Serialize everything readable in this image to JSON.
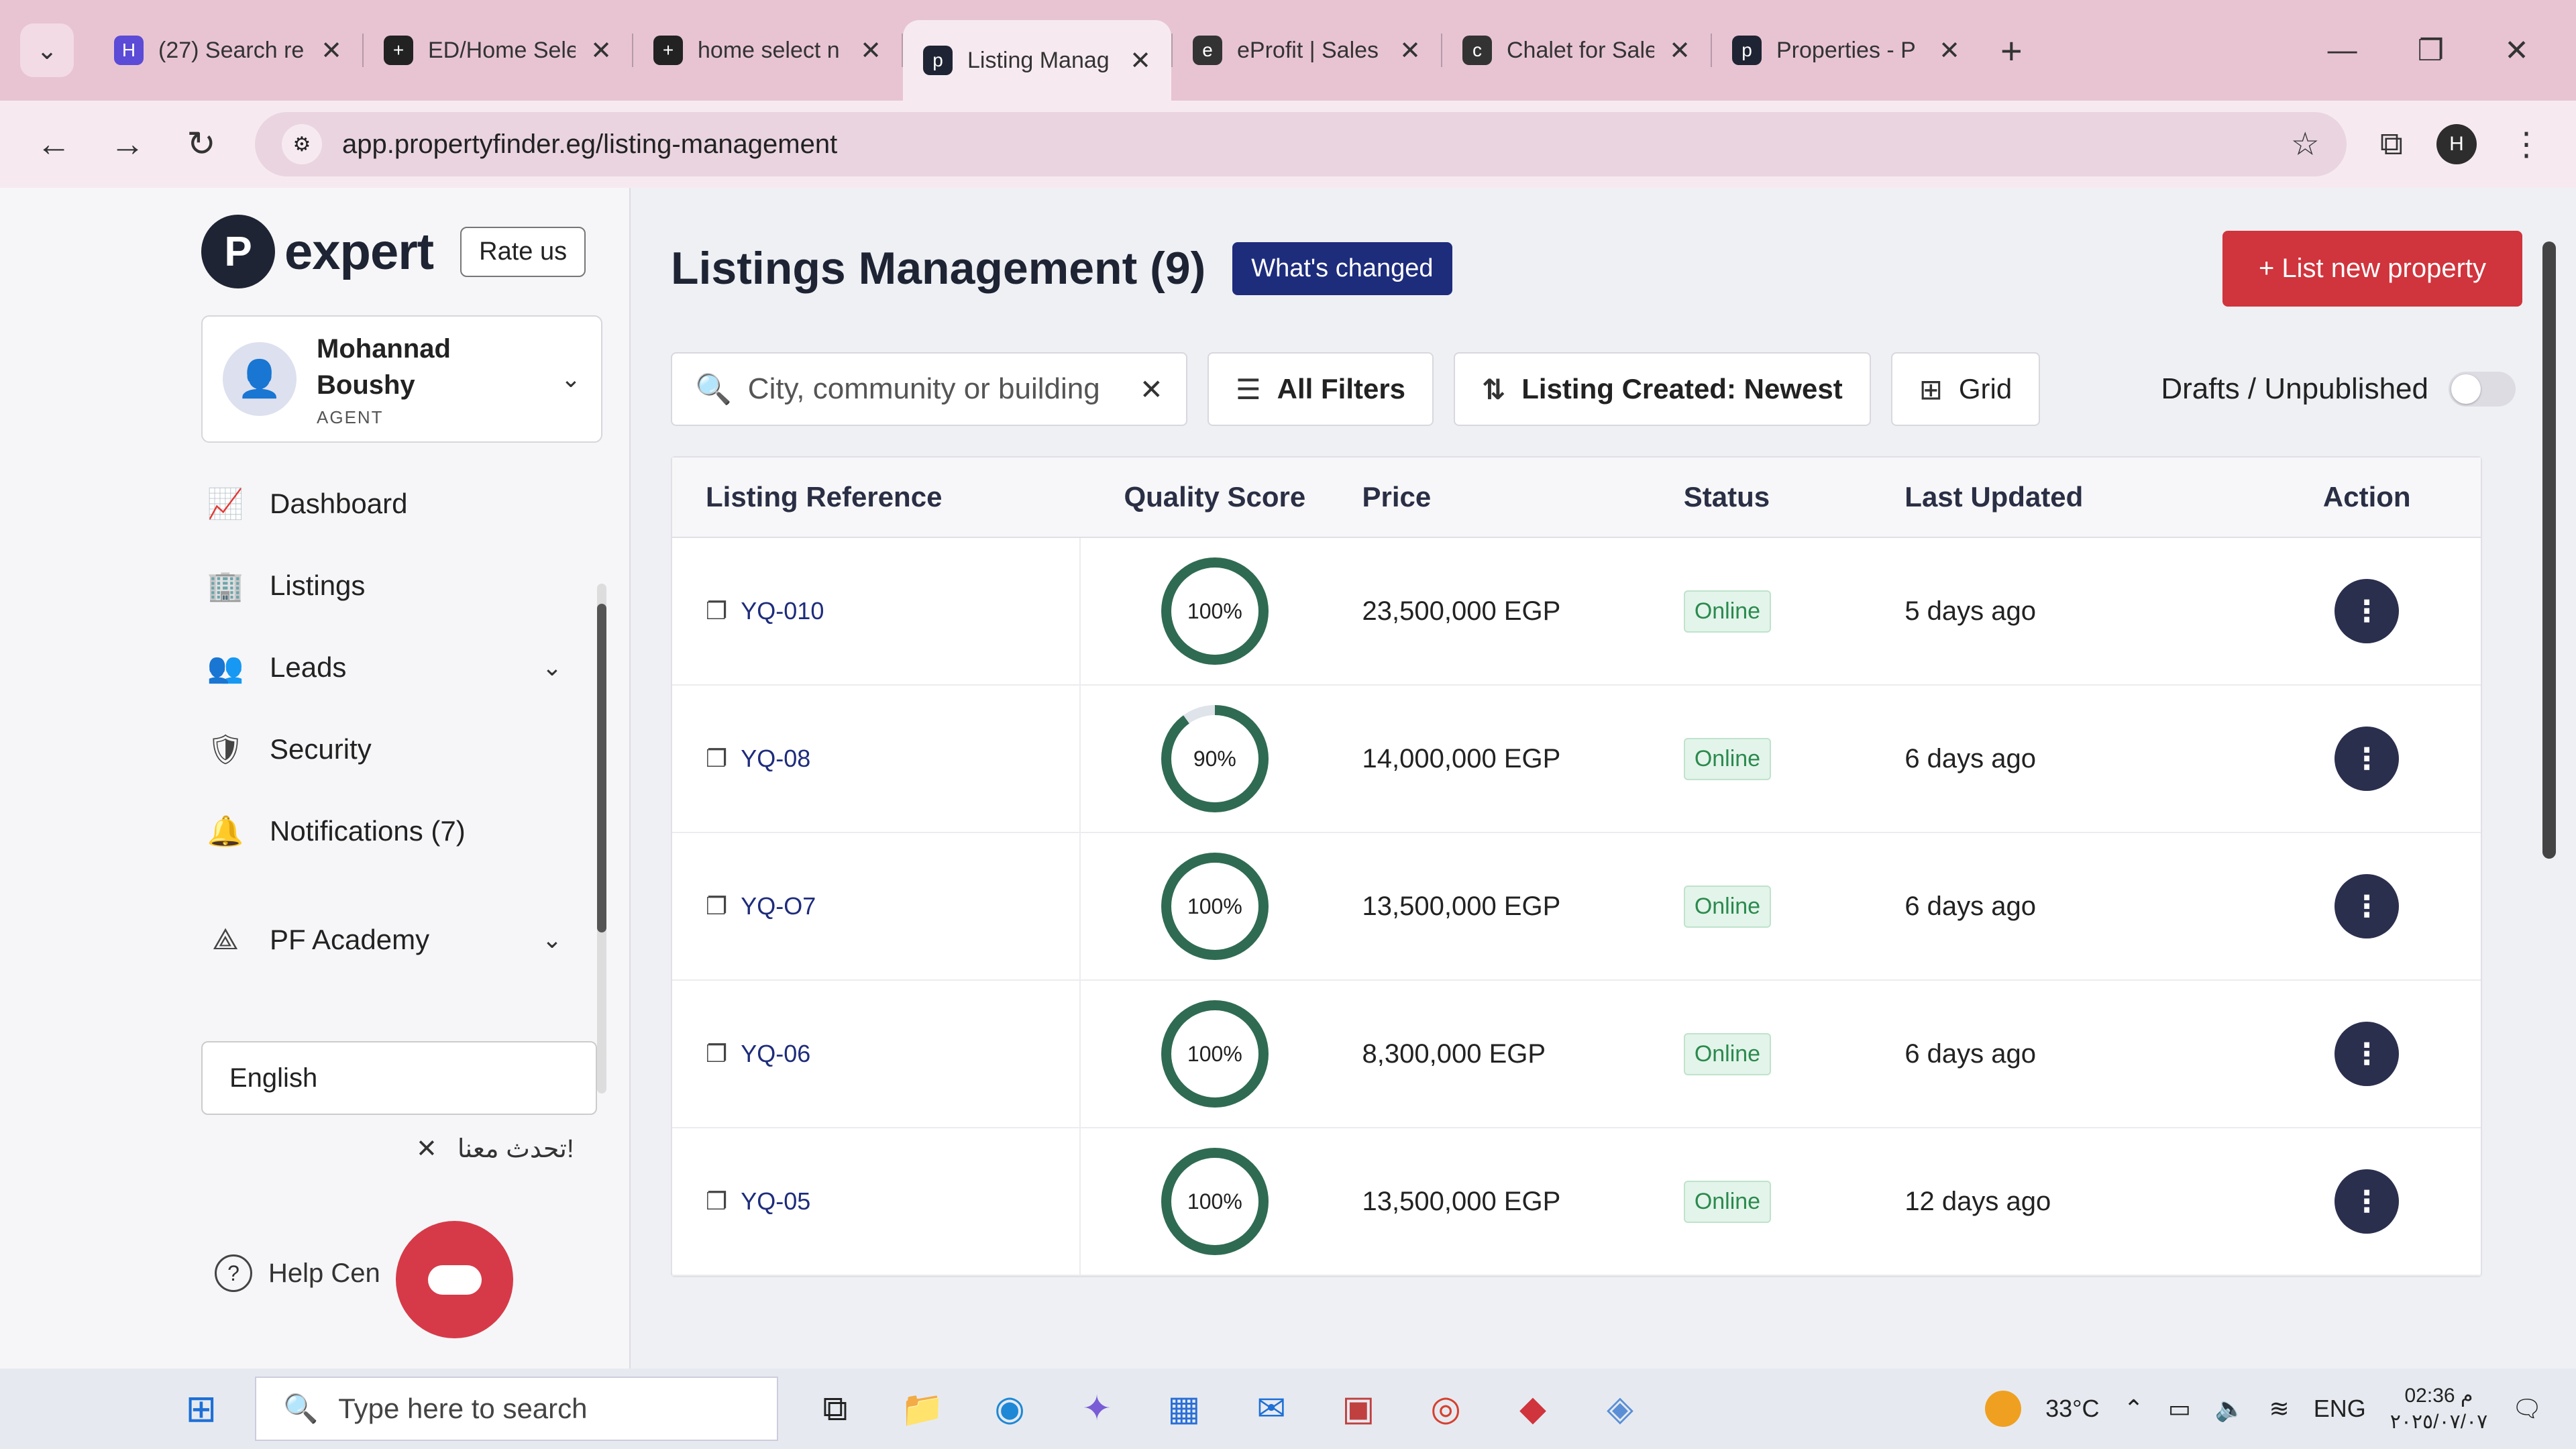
{
  "browser": {
    "tabs": [
      {
        "title": "(27) Search re",
        "favicon_color": "#5b4bd6",
        "favicon_glyph": "H",
        "active": false
      },
      {
        "title": "ED/Home Sele",
        "favicon_color": "#222222",
        "favicon_glyph": "+",
        "active": false
      },
      {
        "title": "home select n",
        "favicon_color": "#222222",
        "favicon_glyph": "+",
        "active": false
      },
      {
        "title": "Listing Manag",
        "favicon_color": "#1e2433",
        "favicon_glyph": "p",
        "active": true
      },
      {
        "title": "eProfit | Sales",
        "favicon_color": "#333333",
        "favicon_glyph": "e",
        "active": false
      },
      {
        "title": "Chalet for Sale",
        "favicon_color": "#333333",
        "favicon_glyph": "c",
        "active": false
      },
      {
        "title": "Properties - P",
        "favicon_color": "#1e2433",
        "favicon_glyph": "p",
        "active": false
      }
    ],
    "url": "app.propertyfinder.eg/listing-management",
    "profile_initial": "H"
  },
  "sidebar": {
    "logo_text": "expert",
    "rate_label": "Rate us",
    "user": {
      "name_line1": "Mohannad",
      "name_line2": "Boushy",
      "role": "AGENT"
    },
    "items": [
      {
        "label": "Dashboard",
        "icon": "chart-icon",
        "glyph": "📈"
      },
      {
        "label": "Listings",
        "icon": "building-icon",
        "glyph": "🏢"
      },
      {
        "label": "Leads",
        "icon": "people-icon",
        "glyph": "👥",
        "has_chevron": true
      },
      {
        "label": "Security",
        "icon": "shield-icon",
        "glyph": "🛡"
      },
      {
        "label": "Notifications (7)",
        "icon": "bell-icon",
        "glyph": "🔔"
      },
      {
        "label": "PF Academy",
        "icon": "academy-icon",
        "glyph": "⟁",
        "has_chevron": true
      }
    ],
    "language": "English",
    "chat_hint": "تحدث معنا!",
    "help_label": "Help Cen"
  },
  "main": {
    "title": "Listings Management (9)",
    "whats_changed": "What's changed",
    "new_property": "+ List new property",
    "search_placeholder": "City, community or building",
    "all_filters": "All Filters",
    "sort_label": "Listing Created: Newest",
    "grid_label": "Grid",
    "drafts_label": "Drafts / Unpublished",
    "columns": [
      "Listing Reference",
      "Quality Score",
      "Price",
      "Status",
      "Last Updated",
      "Action"
    ],
    "rows": [
      {
        "ref": "YQ-010",
        "score_text": "100%",
        "score": 100,
        "price": "23,500,000 EGP",
        "status": "Online",
        "updated": "5 days ago"
      },
      {
        "ref": "YQ-08",
        "score_text": "90%",
        "score": 90,
        "price": "14,000,000 EGP",
        "status": "Online",
        "updated": "6 days ago"
      },
      {
        "ref": "YQ-O7",
        "score_text": "100%",
        "score": 100,
        "price": "13,500,000 EGP",
        "status": "Online",
        "updated": "6 days ago"
      },
      {
        "ref": "YQ-06",
        "score_text": "100%",
        "score": 100,
        "price": "8,300,000 EGP",
        "status": "Online",
        "updated": "6 days ago"
      },
      {
        "ref": "YQ-05",
        "score_text": "100%",
        "score": 100,
        "price": "13,500,000 EGP",
        "status": "Online",
        "updated": "12 days ago"
      }
    ]
  },
  "taskbar": {
    "search_placeholder": "Type here to search",
    "temperature": "33°C",
    "language": "ENG",
    "time": "02:36 م",
    "date": "٢٠٢٥/٠٧/٠٧"
  },
  "colors": {
    "accent_red": "#d0343c",
    "navy": "#1e2c7c",
    "ring_green": "#2f6b52",
    "online_green": "#2b8a4e"
  }
}
